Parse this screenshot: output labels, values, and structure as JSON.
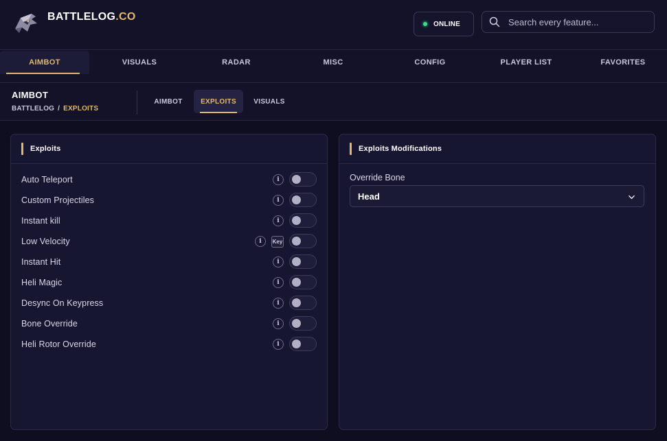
{
  "brand": {
    "name": "BATTLELOG",
    "suffix": ".CO"
  },
  "header": {
    "status_label": "ONLINE",
    "search_placeholder": "Search every feature..."
  },
  "main_nav": {
    "tabs": [
      {
        "label": "AIMBOT",
        "active": true
      },
      {
        "label": "VISUALS",
        "active": false
      },
      {
        "label": "RADAR",
        "active": false
      },
      {
        "label": "MISC",
        "active": false
      },
      {
        "label": "CONFIG",
        "active": false
      },
      {
        "label": "PLAYER LIST",
        "active": false
      },
      {
        "label": "FAVORITES",
        "active": false
      }
    ]
  },
  "subheader": {
    "title": "AIMBOT",
    "breadcrumb_root": "BATTLELOG",
    "breadcrumb_sep": "/",
    "breadcrumb_current": "EXPLOITS",
    "tabs": [
      {
        "label": "AIMBOT",
        "active": false
      },
      {
        "label": "EXPLOITS",
        "active": true
      },
      {
        "label": "VISUALS",
        "active": false
      }
    ]
  },
  "exploits_panel": {
    "title": "Exploits",
    "info_glyph": "i",
    "items": [
      {
        "label": "Auto Teleport",
        "enabled": false
      },
      {
        "label": "Custom Projectiles",
        "enabled": false
      },
      {
        "label": "Instant kill",
        "enabled": false
      },
      {
        "label": "Low Velocity",
        "enabled": false,
        "key_label": "Key"
      },
      {
        "label": "Instant Hit",
        "enabled": false
      },
      {
        "label": "Heli Magic",
        "enabled": false
      },
      {
        "label": "Desync On Keypress",
        "enabled": false
      },
      {
        "label": "Bone Override",
        "enabled": false
      },
      {
        "label": "Heli Rotor Override",
        "enabled": false
      }
    ]
  },
  "modifications_panel": {
    "title": "Exploits Modifications",
    "override_bone_label": "Override Bone",
    "override_bone_value": "Head"
  },
  "colors": {
    "accent": "#e2b86a",
    "background": "#0f0e20",
    "panel": "#171631",
    "online": "#3fdc8a"
  }
}
